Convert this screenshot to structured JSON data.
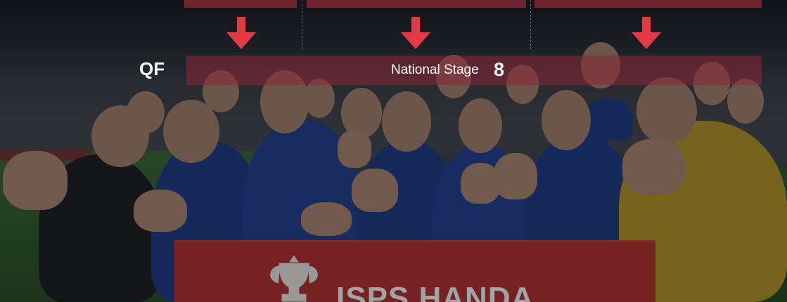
{
  "round": {
    "label": "QF"
  },
  "stage": {
    "name": "National Stage",
    "count": "8"
  },
  "banner": {
    "text": "ISPS HANDA"
  },
  "colors": {
    "accent": "#e63946",
    "bar": "#6e2530",
    "overlay": "#8c2837"
  },
  "icons": [
    "arrow-down-icon",
    "trophy-icon"
  ]
}
